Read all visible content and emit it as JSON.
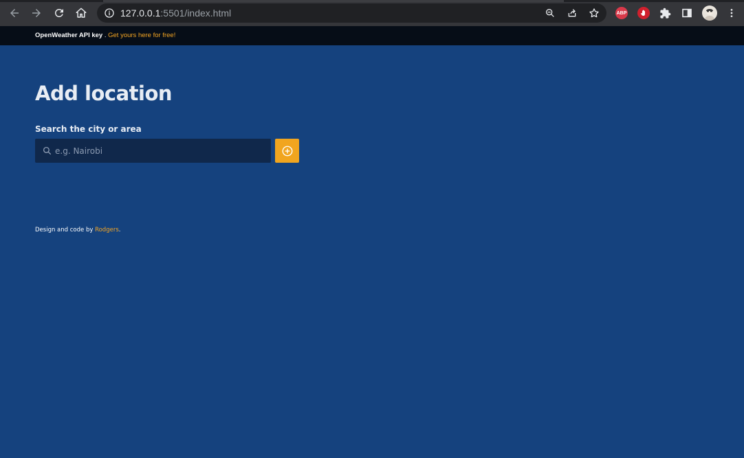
{
  "browser": {
    "url_host": "127.0.0.1",
    "url_rest": ":5501/index.html",
    "extensions": {
      "adblock_label": "ABP"
    }
  },
  "api_bar": {
    "label": "OpenWeather API key",
    "separator": " . ",
    "link_text": "Get yours here for free!"
  },
  "page": {
    "title": "Add location",
    "search_label": "Search the city or area",
    "search_placeholder": "e.g. Nairobi"
  },
  "footer": {
    "prefix": "Design and code by ",
    "author": "Rodgers",
    "suffix": "."
  },
  "colors": {
    "background": "#15427e",
    "accent": "#f1a51f",
    "input_bg": "#10284b",
    "top_bar": "#060d17"
  }
}
